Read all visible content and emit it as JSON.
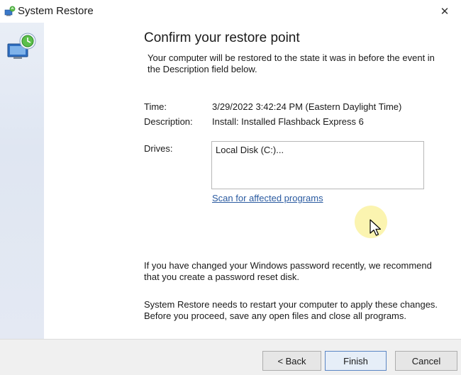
{
  "window": {
    "title": "System Restore",
    "close_glyph": "✕"
  },
  "content": {
    "heading": "Confirm your restore point",
    "intro": "Your computer will be restored to the state it was in before the event in the Description field below.",
    "time_label": "Time:",
    "time_value": "3/29/2022 3:42:24 PM (Eastern Daylight Time)",
    "description_label": "Description:",
    "description_value": "Install: Installed Flashback Express 6",
    "drives_label": "Drives:",
    "drives": [
      "Local Disk (C:)..."
    ],
    "scan_link": "Scan for affected programs",
    "password_note": "If you have changed your Windows password recently, we recommend that you create a password reset disk.",
    "restart_note": "System Restore needs to restart your computer to apply these changes. Before you proceed, save any open files and close all programs."
  },
  "footer": {
    "back_label": "< Back",
    "finish_label": "Finish",
    "cancel_label": "Cancel"
  },
  "icons": {
    "title_icon": "system-restore-icon",
    "sidebar_icon": "computer-restore-icon",
    "close_icon": "close-icon",
    "cursor_icon": "mouse-cursor-icon"
  },
  "colors": {
    "link": "#2a5aa0",
    "sidebar": "#e4e9f3",
    "footer": "#f0f0f0"
  }
}
